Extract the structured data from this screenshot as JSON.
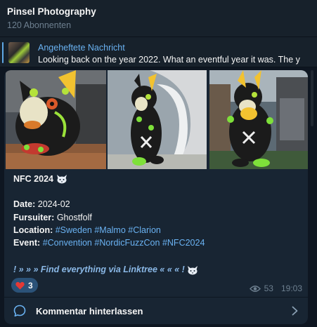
{
  "header": {
    "channel_title": "Pinsel Photography",
    "subscribers": "120 Abonnenten"
  },
  "pinned": {
    "label": "Angeheftete Nachricht",
    "preview": "Looking back on the year 2022. What an eventful year it was.  The y"
  },
  "message": {
    "title": "NFC 2024",
    "title_icon": "cat-face-icon",
    "fields": {
      "date_label": "Date:",
      "date_value": "2024-02",
      "fursuiter_label": "Fursuiter:",
      "fursuiter_value": "Ghostfolf",
      "location_label": "Location:",
      "location_tags": [
        "#Sweden",
        "#Malmo",
        "#Clarion"
      ],
      "event_label": "Event:",
      "event_tags": [
        "#Convention",
        "#NordicFuzzCon",
        "#NFC2024"
      ]
    },
    "linktree_text": "! » » » Find everything via Linktree « « « !",
    "linktree_icon": "cat-face-icon",
    "reaction": {
      "icon": "heart-icon",
      "count": "3"
    },
    "views": "53",
    "time": "19:03"
  },
  "comments": {
    "label": "Kommentar hinterlassen"
  },
  "colors": {
    "background": "#0e1621",
    "header": "#17212b",
    "bubble": "#182533",
    "link": "#6ab2f2",
    "muted": "#6d7f8f",
    "reaction_bg": "#2b5278",
    "heart": "#e53935"
  }
}
